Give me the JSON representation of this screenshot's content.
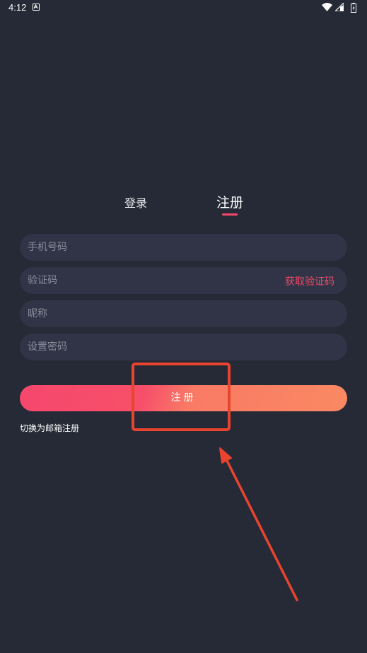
{
  "status_bar": {
    "time": "4:12",
    "icons": [
      "a-notification-icon",
      "wifi-icon",
      "signal-icon",
      "battery-icon"
    ]
  },
  "tabs": [
    {
      "label": "登录",
      "active": false
    },
    {
      "label": "注册",
      "active": true
    }
  ],
  "form": {
    "phone_placeholder": "手机号码",
    "code_placeholder": "验证码",
    "get_code_label": "获取验证码",
    "nickname_placeholder": "昵称",
    "password_placeholder": "设置密码",
    "submit_label": "注册",
    "switch_email_label": "切换为邮箱注册"
  },
  "colors": {
    "background": "#262a36",
    "field_background": "#313447",
    "accent": "#f2496b",
    "gradient_start": "#f6476c",
    "gradient_end": "#fa8963",
    "annotation": "#e8442e"
  }
}
